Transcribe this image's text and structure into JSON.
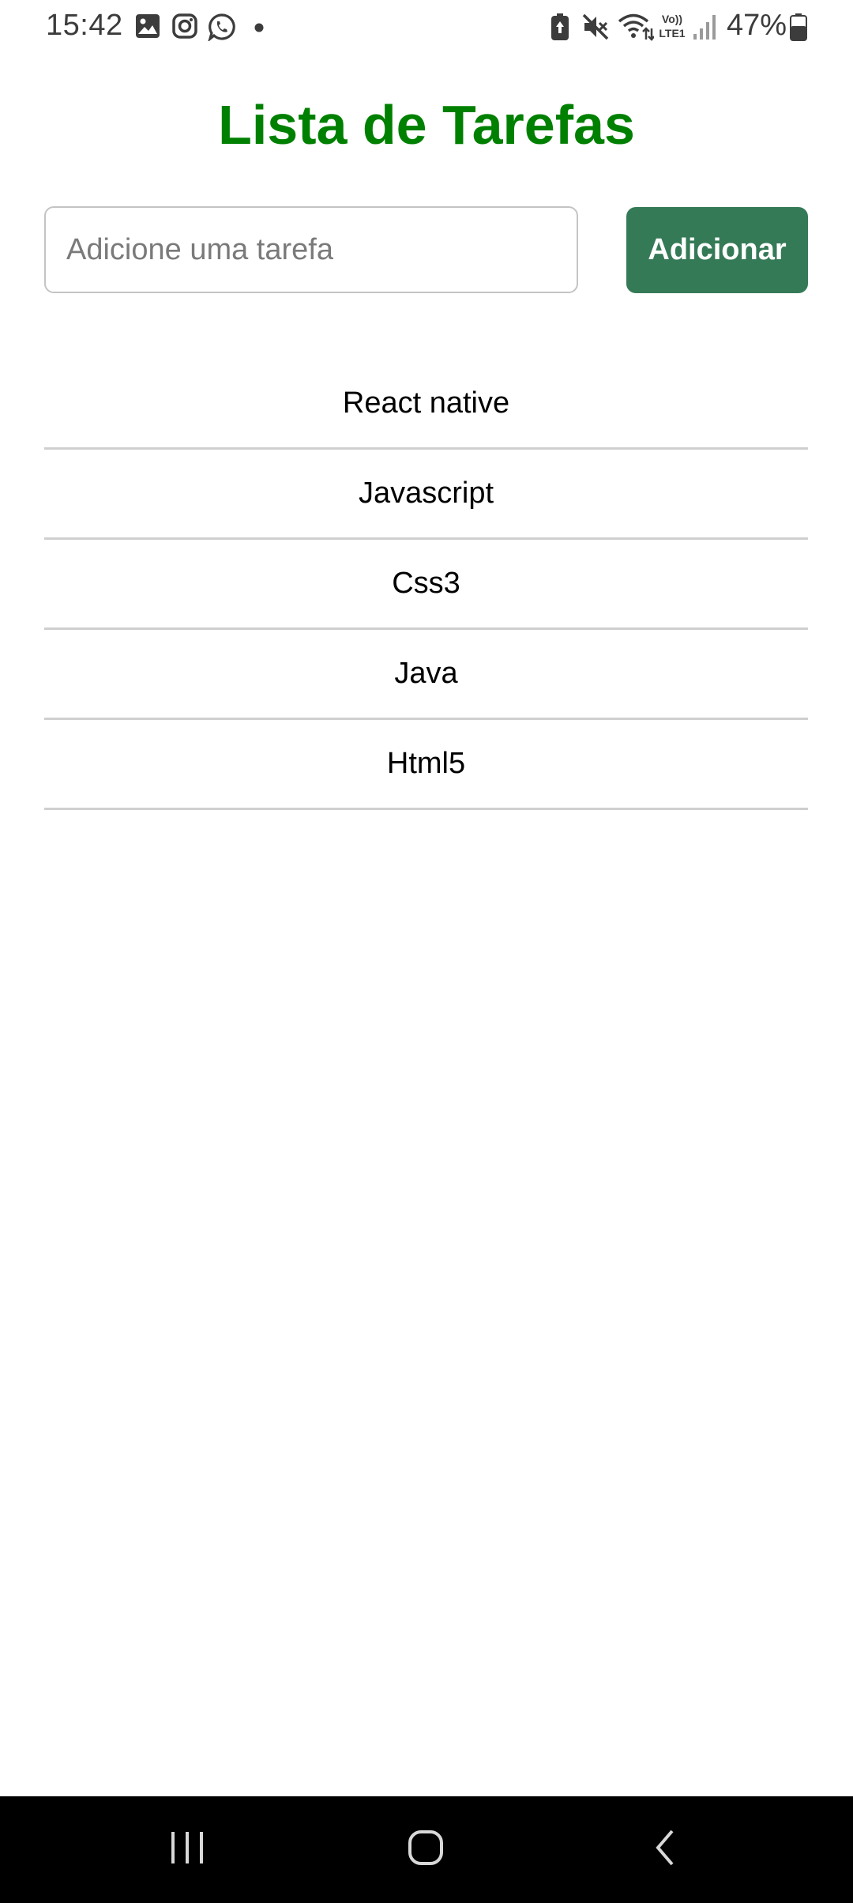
{
  "status_bar": {
    "time": "15:42",
    "left_icons": [
      "gallery-icon",
      "instagram-icon",
      "whatsapp-icon",
      "notification-dot-icon"
    ],
    "right_icons": [
      "battery-saver-icon",
      "mute-icon",
      "wifi-icon",
      "volte-lte-icon",
      "signal-icon",
      "battery-icon"
    ],
    "volte_text": "Vo)) LTE1",
    "battery_percent": "47%"
  },
  "app": {
    "title": "Lista de Tarefas",
    "title_color": "#008000"
  },
  "input": {
    "value": "",
    "placeholder": "Adicione uma tarefa"
  },
  "add_button": {
    "label": "Adicionar",
    "color": "#357a57"
  },
  "tasks": [
    {
      "label": "React native"
    },
    {
      "label": "Javascript"
    },
    {
      "label": "Css3"
    },
    {
      "label": "Java"
    },
    {
      "label": "Html5"
    }
  ],
  "nav_bar": {
    "buttons": [
      "recent-apps-icon",
      "home-icon",
      "back-icon"
    ]
  }
}
